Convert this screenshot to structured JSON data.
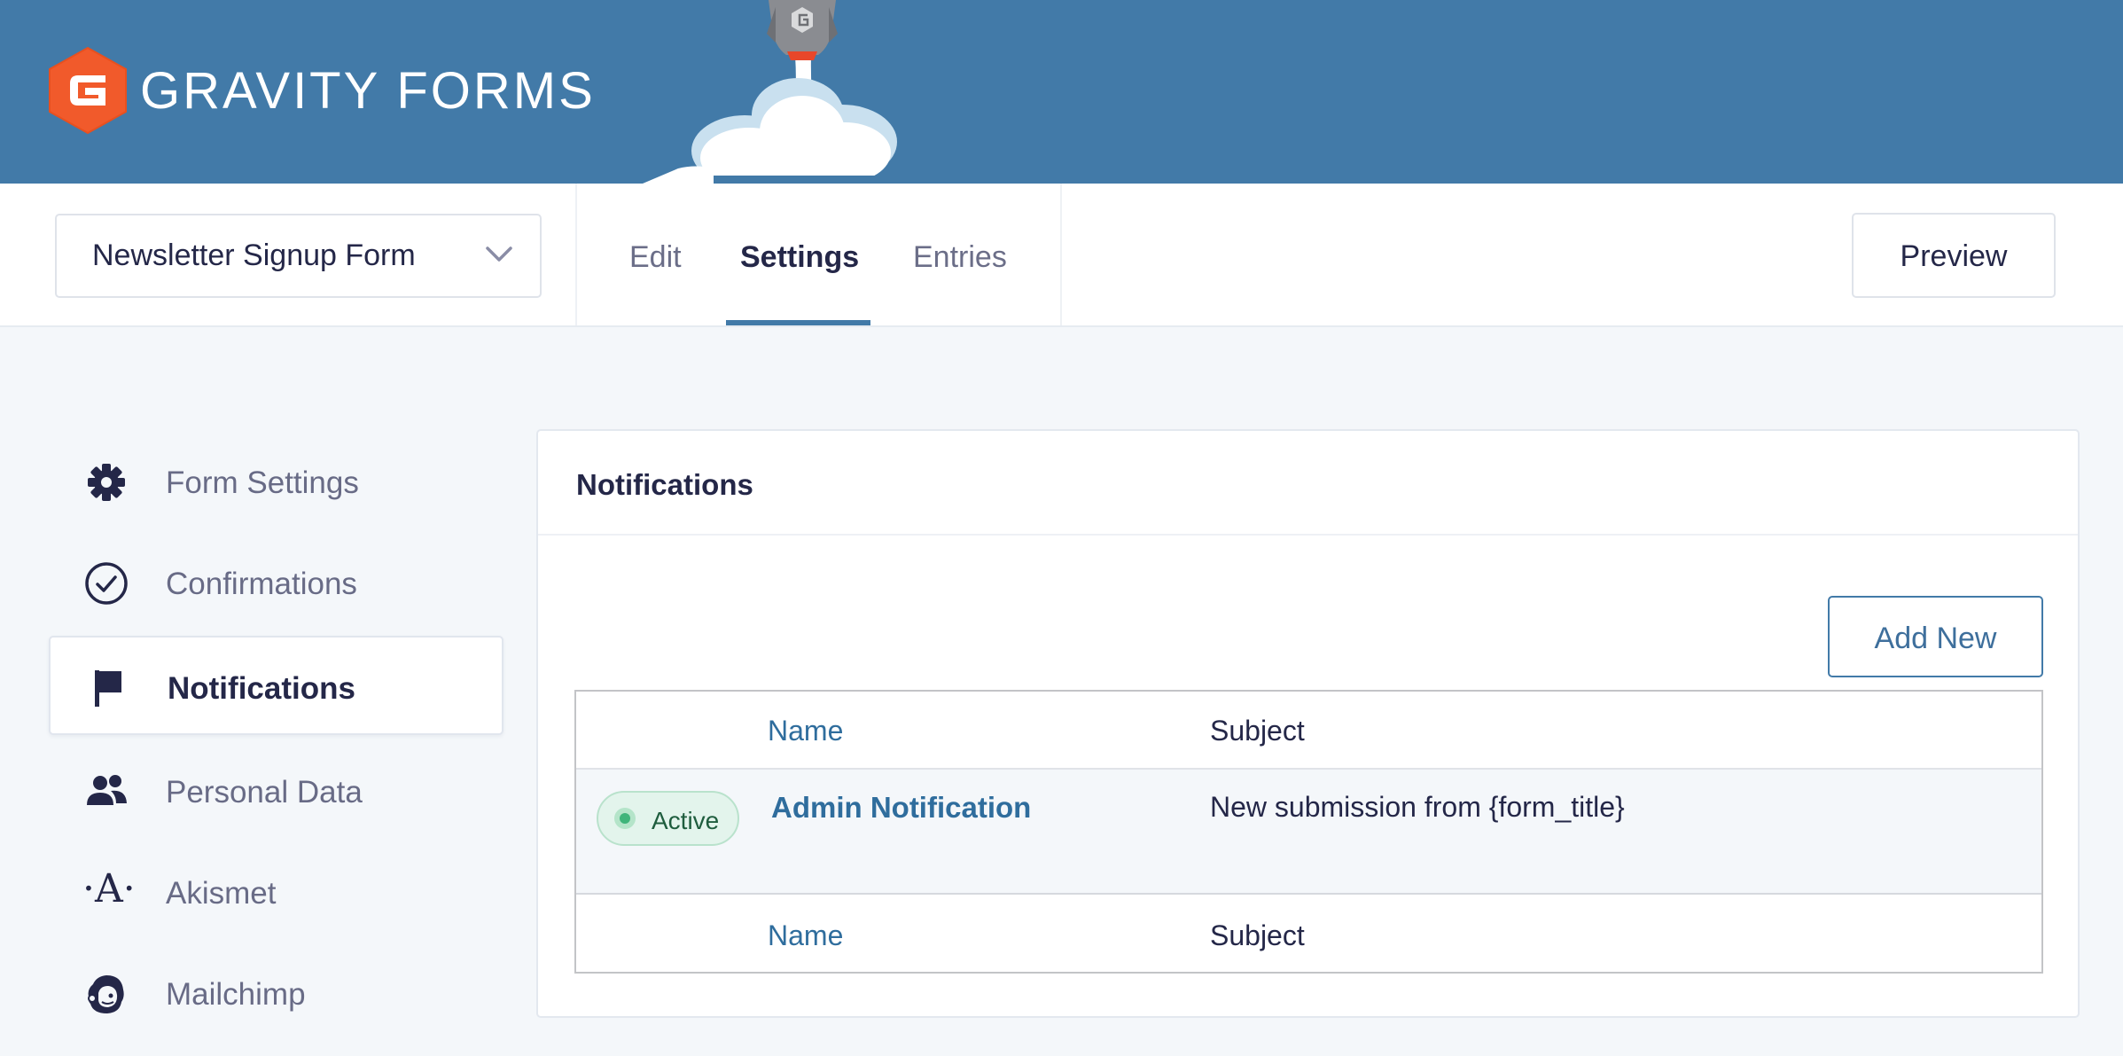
{
  "header": {
    "brand": "GRAVITY FORMS",
    "background_color": "#427aa8",
    "accent_color": "#f15a2b"
  },
  "nav": {
    "form_selector": {
      "value": "Newsletter Signup Form",
      "icon": "chevron-down-icon"
    },
    "tabs": [
      {
        "label": "Edit",
        "active": false
      },
      {
        "label": "Settings",
        "active": true
      },
      {
        "label": "Entries",
        "active": false
      }
    ],
    "preview_label": "Preview"
  },
  "sidebar": {
    "items": [
      {
        "label": "Form Settings",
        "icon": "gear-icon",
        "active": false
      },
      {
        "label": "Confirmations",
        "icon": "check-circle-icon",
        "active": false
      },
      {
        "label": "Notifications",
        "icon": "flag-icon",
        "active": true
      },
      {
        "label": "Personal Data",
        "icon": "users-icon",
        "active": false
      },
      {
        "label": "Akismet",
        "icon": "akismet-icon",
        "glyph": "·A·",
        "active": false
      },
      {
        "label": "Mailchimp",
        "icon": "mailchimp-icon",
        "active": false
      }
    ]
  },
  "main": {
    "title": "Notifications",
    "add_new_label": "Add New",
    "table": {
      "columns": [
        "Name",
        "Subject"
      ],
      "rows": [
        {
          "status": "Active",
          "name": "Admin Notification",
          "subject": "New submission from {form_title}"
        }
      ],
      "footer": [
        "Name",
        "Subject"
      ]
    },
    "status_color": "#3fb47a",
    "link_color": "#2f6d9d"
  }
}
